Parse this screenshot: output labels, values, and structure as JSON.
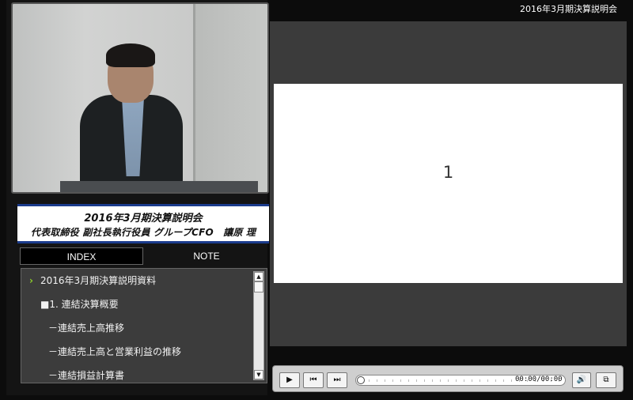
{
  "header": {
    "event_title": "2016年3月期決算説明会"
  },
  "presenter": {
    "event": "2016年3月期決算説明会",
    "name_line": "代表取締役 副社長執行役員 グループCFO　讓原 理"
  },
  "tabs": [
    {
      "label": "INDEX",
      "active": true
    },
    {
      "label": "NOTE",
      "active": false
    }
  ],
  "index": {
    "items": [
      {
        "label": "2016年3月期決算説明資料",
        "current": true
      },
      {
        "label": "■1. 連結決算概要"
      },
      {
        "label": "－連結売上高推移"
      },
      {
        "label": "－連結売上高と営業利益の推移"
      },
      {
        "label": "－連結損益計算書"
      }
    ],
    "current_marker": "›"
  },
  "slide": {
    "number": "1"
  },
  "player": {
    "play_icon": "▶",
    "prev_icon": "⏮",
    "next_icon": "⏭",
    "time": "00:00/00:00",
    "volume_icon": "🔊",
    "popout_icon": "⧉",
    "progress": 0
  },
  "scrollbar": {
    "up": "▲",
    "down": "▼"
  },
  "colors": {
    "accent_arrow": "#8fd12b",
    "title_border": "#1b3b8c"
  }
}
